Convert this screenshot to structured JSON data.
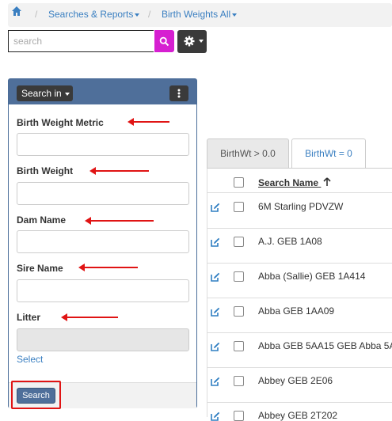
{
  "breadcrumb": {
    "home_icon": "home-icon",
    "items": [
      "Searches & Reports",
      "Birth Weights All"
    ]
  },
  "search": {
    "placeholder": "search",
    "value": ""
  },
  "panel": {
    "search_in_label": "Search in",
    "fields": [
      {
        "label": "Birth Weight Metric",
        "value": ""
      },
      {
        "label": "Birth Weight",
        "value": ""
      },
      {
        "label": "Dam Name",
        "value": ""
      },
      {
        "label": "Sire Name",
        "value": ""
      },
      {
        "label": "Litter",
        "value": ""
      }
    ],
    "select_link": "Select",
    "search_button": "Search"
  },
  "tabs": [
    "BirthWt > 0.0",
    "BirthWt = 0"
  ],
  "table": {
    "column": "Search Name",
    "rows": [
      "6M Starling PDVZW",
      "A.J. GEB 1A08",
      "Abba (Sallie) GEB 1A414",
      "Abba GEB 1AA09",
      "Abba GEB 5AA15 GEB Abba 5A",
      "Abbey GEB 2E06",
      "Abbey GEB 2T202"
    ]
  },
  "colors": {
    "accent": "#d61fd1",
    "panel_header": "#4f6f9a",
    "annotation": "#e01414",
    "link": "#3a7fc1"
  }
}
